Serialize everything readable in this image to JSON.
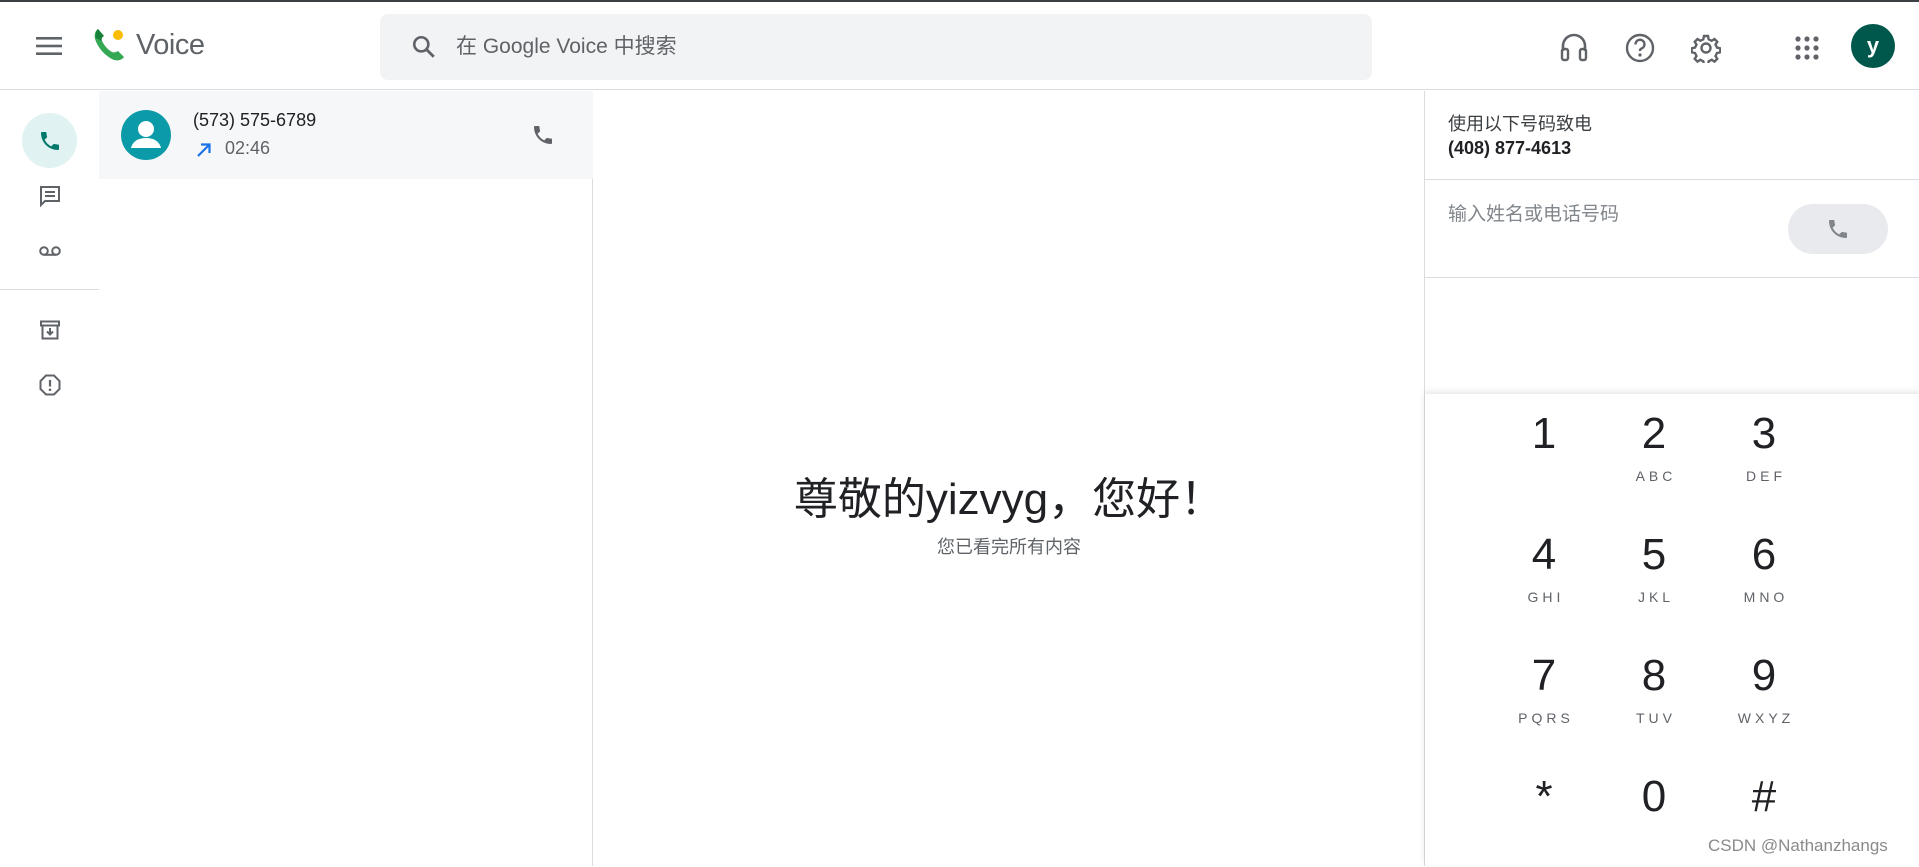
{
  "header": {
    "app_name": "Voice",
    "search_placeholder": "在 Google Voice 中搜索",
    "avatar_letter": "y"
  },
  "calls": [
    {
      "number": "(573) 575-6789",
      "direction": "outgoing",
      "time": "02:46"
    }
  ],
  "main": {
    "greeting": "尊敬的yizvyg，您好！",
    "subtitle": "您已看完所有内容"
  },
  "dialer": {
    "call_from_label": "使用以下号码致电",
    "call_from_number": "(408) 877-4613",
    "input_placeholder": "输入姓名或电话号码",
    "keys": [
      {
        "digit": "1",
        "letters": ""
      },
      {
        "digit": "2",
        "letters": "ABC"
      },
      {
        "digit": "3",
        "letters": "DEF"
      },
      {
        "digit": "4",
        "letters": "GHI"
      },
      {
        "digit": "5",
        "letters": "JKL"
      },
      {
        "digit": "6",
        "letters": "MNO"
      },
      {
        "digit": "7",
        "letters": "PQRS"
      },
      {
        "digit": "8",
        "letters": "TUV"
      },
      {
        "digit": "9",
        "letters": "WXYZ"
      },
      {
        "digit": "*",
        "letters": ""
      },
      {
        "digit": "0",
        "letters": ""
      },
      {
        "digit": "#",
        "letters": ""
      }
    ]
  },
  "watermark": "CSDN @Nathanzhangs",
  "colors": {
    "accent": "#00796b",
    "avatar_bg": "#00574b",
    "contact_avatar": "#0b9aa7",
    "outgoing_arrow": "#1a73e8"
  }
}
